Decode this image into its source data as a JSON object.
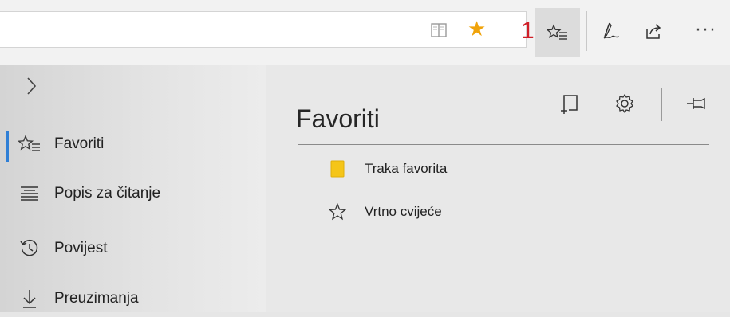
{
  "toolbar": {
    "address_value": "",
    "annotation_number": "1",
    "icons": {
      "reading_view": "reading-view-icon",
      "favorite_star": "star-filled-icon",
      "hub": "hub-favorites-icon",
      "notes": "pen-notes-icon",
      "share": "share-icon",
      "more": "more-dots-icon"
    },
    "more_label": "···",
    "colors": {
      "star": "#f0a30a",
      "annotation": "#d01f28"
    }
  },
  "sidebar": {
    "toggle_icon": "chevron-right-icon",
    "items": [
      {
        "label": "Favoriti",
        "icon": "favorites-icon",
        "active": true
      },
      {
        "label": "Popis za čitanje",
        "icon": "reading-list-icon",
        "active": false
      },
      {
        "label": "Povijest",
        "icon": "history-icon",
        "active": false
      },
      {
        "label": "Preuzimanja",
        "icon": "download-icon",
        "active": false
      }
    ],
    "accent": "#2f7fd6"
  },
  "favorites": {
    "title": "Favoriti",
    "actions": [
      "add-folder-icon",
      "gear-icon",
      "pin-icon"
    ],
    "items": [
      {
        "label": "Traka favorita",
        "icon": "folder-icon",
        "color": "#f5c518"
      },
      {
        "label": "Vrtno cvijeće",
        "icon": "star-outline-icon"
      }
    ]
  }
}
